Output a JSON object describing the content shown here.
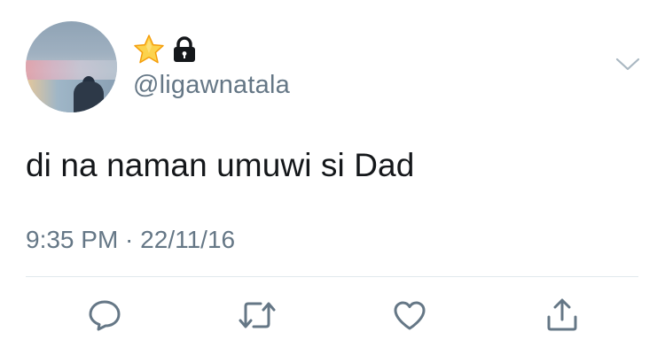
{
  "profile": {
    "handle": "@ligawnatala",
    "badges": [
      "star-icon",
      "lock-icon"
    ]
  },
  "tweet": {
    "text": "di na naman umuwi si Dad",
    "time": "9:35 PM",
    "separator": " · ",
    "date": "22/11/16"
  },
  "actions": [
    "reply-icon",
    "retweet-icon",
    "like-icon",
    "share-icon"
  ],
  "menu": {
    "icon": "chevron-down-icon"
  },
  "colors": {
    "text": "#14171a",
    "secondary": "#657786",
    "divider": "#e1e8ed",
    "star": "#f5c518"
  }
}
